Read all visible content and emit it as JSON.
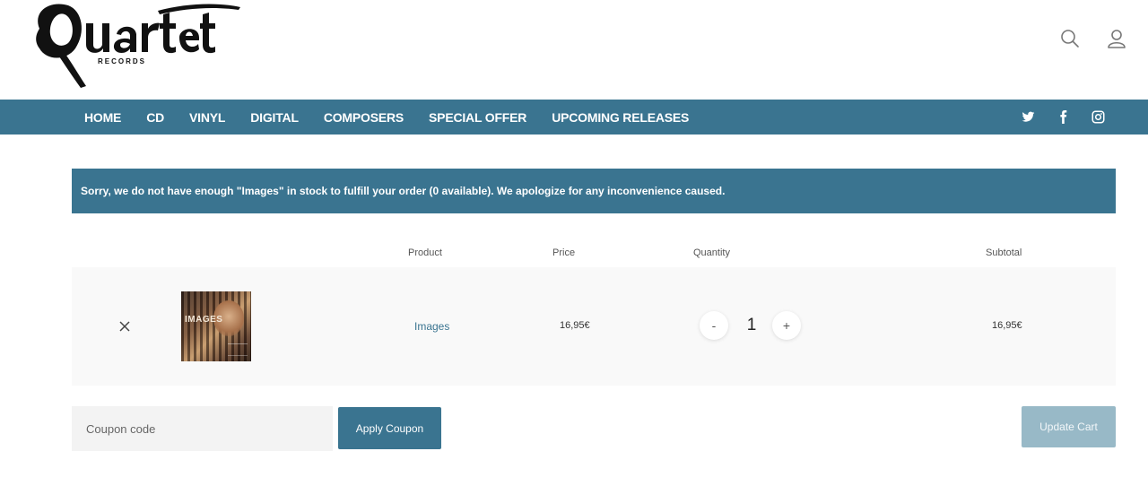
{
  "brand": {
    "name": "Quartet",
    "tagline": "RECORDS"
  },
  "header": {
    "icons": [
      "search-icon",
      "user-icon"
    ]
  },
  "nav": {
    "items": [
      {
        "label": "HOME"
      },
      {
        "label": "CD"
      },
      {
        "label": "VINYL"
      },
      {
        "label": "DIGITAL"
      },
      {
        "label": "COMPOSERS"
      },
      {
        "label": "SPECIAL OFFER"
      },
      {
        "label": "UPCOMING RELEASES"
      }
    ],
    "social": [
      "twitter-icon",
      "facebook-icon",
      "instagram-icon"
    ]
  },
  "notice": {
    "message": "Sorry, we do not have enough \"Images\" in stock to fulfill your order (0 available). We apologize for any inconvenience caused."
  },
  "cart": {
    "headers": {
      "product": "Product",
      "price": "Price",
      "quantity": "Quantity",
      "subtotal": "Subtotal"
    },
    "items": [
      {
        "cover_text": "IMAGES",
        "name": "Images",
        "price": "16,95€",
        "quantity": "1",
        "subtotal": "16,95€"
      }
    ],
    "qty_minus": "-",
    "qty_plus": "+"
  },
  "actions": {
    "coupon_placeholder": "Coupon code",
    "apply_label": "Apply Coupon",
    "update_label": "Update Cart"
  },
  "colors": {
    "accent": "#3a7490",
    "update_disabled": "#98b9c7",
    "row_bg": "#f9f9f9"
  }
}
